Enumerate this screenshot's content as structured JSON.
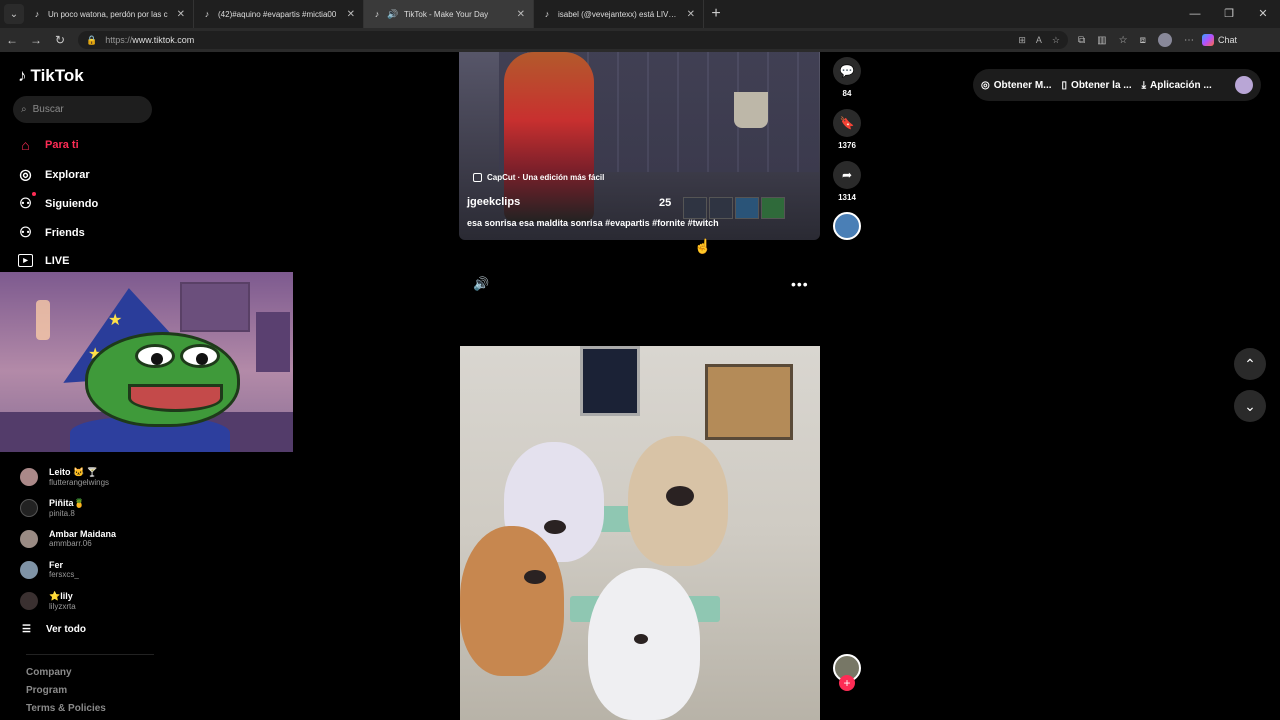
{
  "browser": {
    "tabs": [
      {
        "title": "Un poco watona, perdón por las c",
        "active": false
      },
      {
        "title": "(42)#aquino #evapartis #mictia00",
        "active": false
      },
      {
        "title": "TikTok - Make Your Day",
        "active": true
      },
      {
        "title": "isabel (@vevejantexx) está LIVE: T",
        "active": false
      }
    ],
    "url_prefix": "https://",
    "url_host": "www.tiktok.com",
    "copilot_label": "Chat"
  },
  "sidebar": {
    "brand": "TikTok",
    "search_placeholder": "Buscar",
    "menu": [
      {
        "label": "Para ti",
        "icon": "home-icon"
      },
      {
        "label": "Explorar",
        "icon": "compass-icon"
      },
      {
        "label": "Siguiendo",
        "icon": "following-icon"
      },
      {
        "label": "Friends",
        "icon": "friends-icon"
      },
      {
        "label": "LIVE",
        "icon": "live-icon"
      }
    ],
    "following": [
      {
        "name": "Leito 🐱 🍸",
        "handle": "flutterangelwings"
      },
      {
        "name": "Piñita🍍",
        "handle": "pinita.8"
      },
      {
        "name": "Ambar Maidana",
        "handle": "ammbarr.06"
      },
      {
        "name": "Fer",
        "handle": "fersxcs_"
      },
      {
        "name": "⭐lily",
        "handle": "lilyzxrta"
      }
    ],
    "see_all": "Ver todo",
    "footer": [
      "Company",
      "Program",
      "Terms & Policies"
    ]
  },
  "video1": {
    "capcut_label": "CapCut · Una edición más fácil",
    "author": "jgeekclips",
    "caption": "esa sonrisa esa maldita sonrisa #evapartis #fornite #twitch",
    "hud_number": "25"
  },
  "actions": {
    "comments": "84",
    "saves": "1376",
    "shares": "1314"
  },
  "topright": {
    "item1": "Obtener M...",
    "item2": "Obtener la ...",
    "item3": "Aplicación ..."
  }
}
